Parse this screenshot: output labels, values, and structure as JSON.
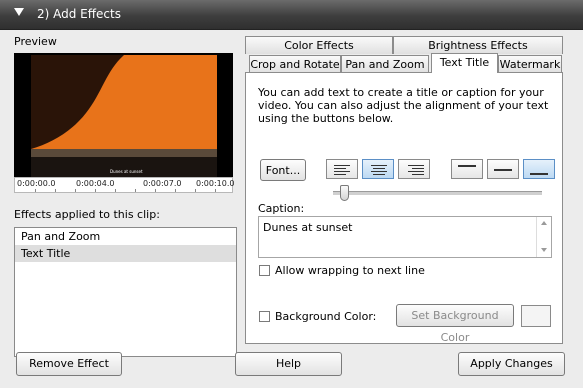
{
  "header": {
    "title": "2)  Add Effects"
  },
  "preview": {
    "label": "Preview",
    "overlay_text": "Dunes at sunset",
    "timeline": [
      "0:00:00.0",
      "0:00:04.0",
      "0:00:07.0",
      "0:00:10.0"
    ]
  },
  "effects": {
    "label": "Effects applied to this clip:",
    "items": [
      "Pan and Zoom",
      "Text Title"
    ],
    "selected": "Text Title"
  },
  "tabs": {
    "row1": [
      "Color Effects",
      "Brightness Effects"
    ],
    "row2": [
      "Crop and Rotate",
      "Pan and Zoom",
      "Text Title",
      "Watermark"
    ],
    "active": "Text Title"
  },
  "text_title": {
    "description": "You can add text to create a title or caption for your video. You can also adjust the alignment of your text using the buttons below.",
    "font_button": "Font...",
    "horizontal_alignment": "center",
    "vertical_alignment": "bottom",
    "caption_label": "Caption:",
    "caption_value": "Dunes at sunset",
    "wrap_label": "Allow wrapping to next line",
    "wrap_checked": false,
    "bgcolor_label": "Background Color:",
    "bgcolor_checked": false,
    "set_bgcolor_button": "Set Background Color"
  },
  "footer": {
    "remove": "Remove Effect",
    "help": "Help",
    "apply": "Apply Changes"
  },
  "colors": {
    "header_bg": "#3e3e3e",
    "selection_bg": "#dedede",
    "active_align": "#bcd9f3",
    "sky_orange": "#e8731a"
  }
}
